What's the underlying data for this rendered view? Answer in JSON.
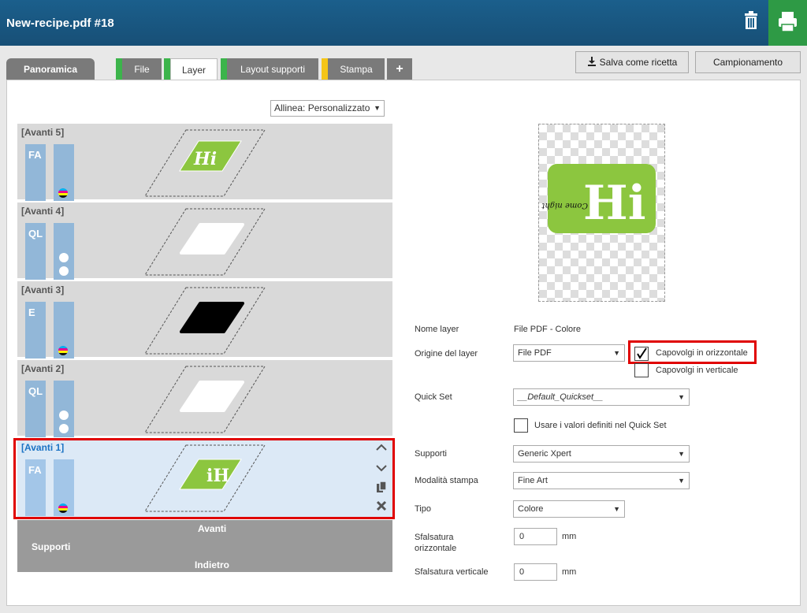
{
  "window": {
    "title": "New-recipe.pdf #18"
  },
  "tabs": [
    {
      "label": "Panoramica"
    },
    {
      "label": "File"
    },
    {
      "label": "Layer"
    },
    {
      "label": "Layout supporti"
    },
    {
      "label": "Stampa"
    },
    {
      "label": "+"
    }
  ],
  "tab_markers": {
    "file": "#3cb44b",
    "layer": "#3cb44b",
    "layout": "#3cb44b",
    "stampa": "#f5c518"
  },
  "toolbar": {
    "save_recipe_label": "Salva come ricetta",
    "sampling_label": "Campionamento"
  },
  "align": {
    "value": "Allinea: Personalizzato"
  },
  "layers": [
    {
      "name": "[Avanti 5]",
      "code": "FA",
      "indicator": "cmyk-icon"
    },
    {
      "name": "[Avanti 4]",
      "code": "QL",
      "indicator": "white-dots"
    },
    {
      "name": "[Avanti 3]",
      "code": "E",
      "indicator": "cmyk-icon"
    },
    {
      "name": "[Avanti 2]",
      "code": "QL",
      "indicator": "white-dots"
    },
    {
      "name": "[Avanti 1]",
      "code": "FA",
      "indicator": "cmyk-icon",
      "selected": true
    }
  ],
  "bottom_bar": {
    "front": "Avanti",
    "media": "Supporti",
    "back": "Indietro"
  },
  "preview": {
    "logo_text": "Hi",
    "logo_script": "Come night in!",
    "logo_color": "#8cc63f"
  },
  "form": {
    "layer_name_label": "Nome layer",
    "layer_name_value": "File PDF - Colore",
    "origin_label": "Origine del layer",
    "origin_value": "File PDF",
    "flip_h_label": "Capovolgi in orizzontale",
    "flip_h_checked": true,
    "flip_v_label": "Capovolgi in verticale",
    "flip_v_checked": false,
    "quickset_label": "Quick Set",
    "quickset_value": "__Default_Quickset__",
    "use_quickset_label": "Usare i valori definiti nel Quick Set",
    "media_label": "Supporti",
    "media_value": "Generic Xpert",
    "print_mode_label": "Modalità stampa",
    "print_mode_value": "Fine Art",
    "type_label": "Tipo",
    "type_value": "Colore",
    "h_offset_label": "Sfalsatura orizzontale",
    "h_offset_value": "0",
    "v_offset_label": "Sfalsatura verticale",
    "v_offset_value": "0",
    "unit": "mm"
  },
  "colors": {
    "header": "#1b5f8c",
    "print_button": "#2e9a45",
    "highlight": "#e00000",
    "selected_layer": "#dce9f6"
  }
}
